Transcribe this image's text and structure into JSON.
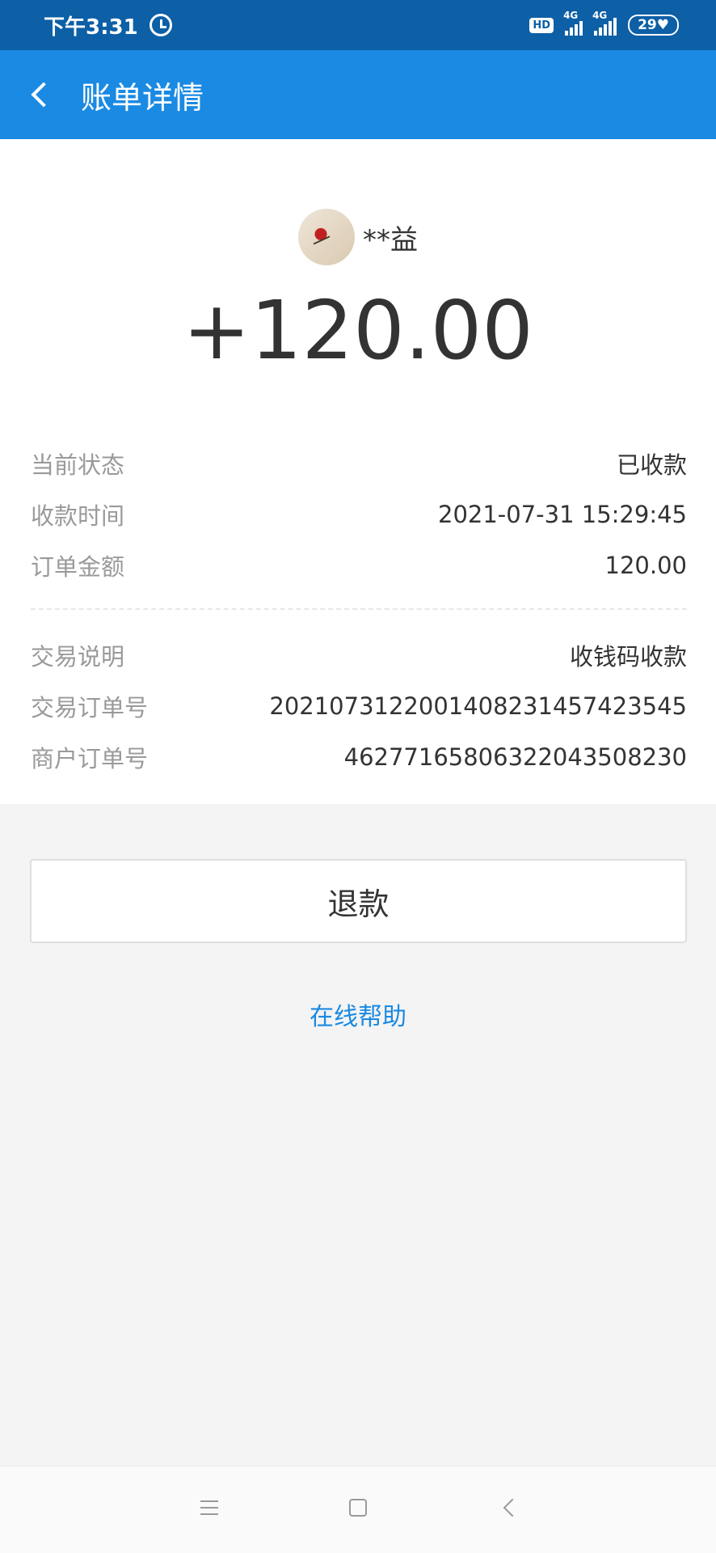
{
  "status_bar": {
    "time": "下午3:31",
    "hd": "HD",
    "network_1": "4G",
    "network_2": "4G",
    "battery": "29"
  },
  "header": {
    "title": "账单详情"
  },
  "payer": {
    "name": "**益"
  },
  "amount": "+120.00",
  "details": [
    {
      "label": "当前状态",
      "value": "已收款"
    },
    {
      "label": "收款时间",
      "value": "2021-07-31 15:29:45"
    },
    {
      "label": "订单金额",
      "value": "120.00"
    },
    {
      "label": "交易说明",
      "value": "收钱码收款"
    },
    {
      "label": "交易订单号",
      "value": "2021073122001408231457423545"
    },
    {
      "label": "商户订单号",
      "value": "4627716580632204350823​0"
    }
  ],
  "actions": {
    "refund_label": "退款",
    "help_label": "在线帮助"
  },
  "colors": {
    "status_bar": "#0d5fa6",
    "header": "#1a8ae3",
    "link": "#1a8ae3"
  }
}
